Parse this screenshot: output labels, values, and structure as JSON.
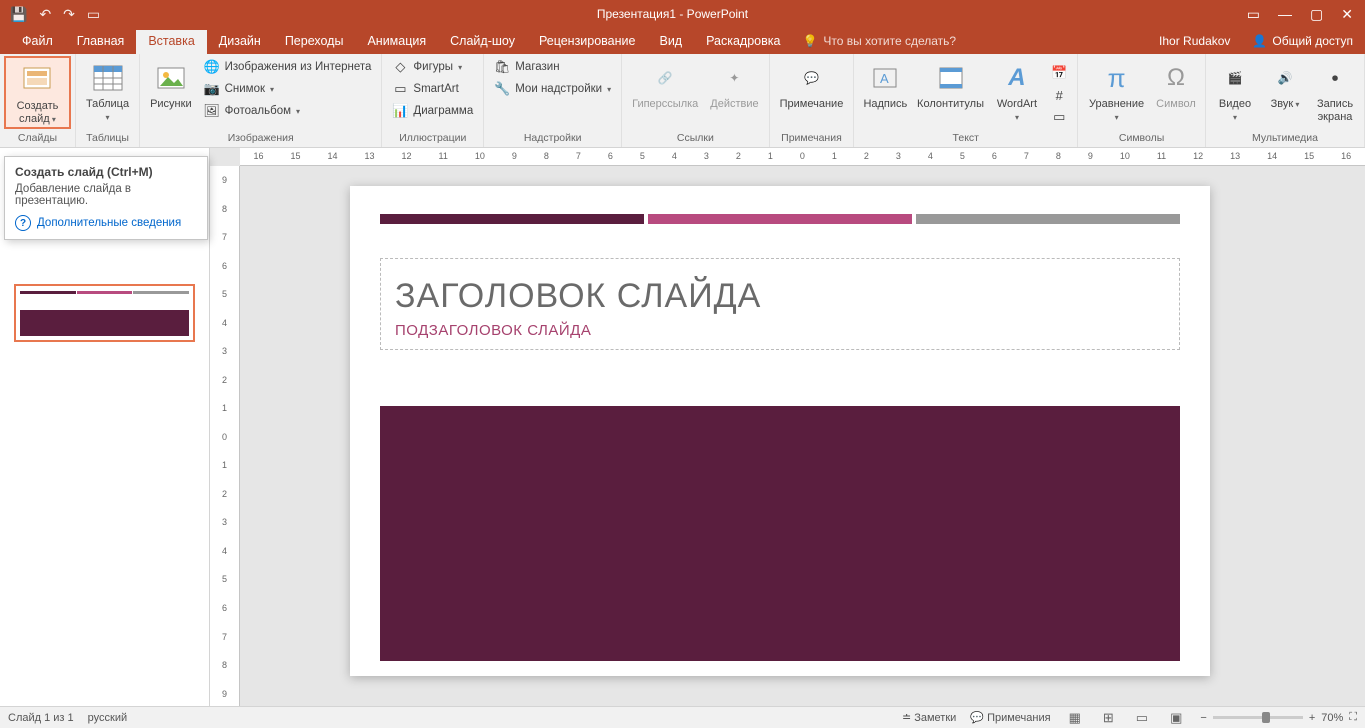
{
  "titlebar": {
    "title": "Презентация1 - PowerPoint"
  },
  "tabs": {
    "file": "Файл",
    "home": "Главная",
    "insert": "Вставка",
    "design": "Дизайн",
    "transitions": "Переходы",
    "animations": "Анимация",
    "slideshow": "Слайд-шоу",
    "review": "Рецензирование",
    "view": "Вид",
    "storyboard": "Раскадровка",
    "tell": "Что вы хотите сделать?",
    "user": "Ihor Rudakov",
    "share": "Общий доступ"
  },
  "ribbon": {
    "slides": {
      "new_slide": "Создать слайд",
      "group": "Слайды"
    },
    "tables": {
      "table": "Таблица",
      "group": "Таблицы"
    },
    "images": {
      "pictures": "Рисунки",
      "online": "Изображения из Интернета",
      "screenshot": "Снимок",
      "album": "Фотоальбом",
      "group": "Изображения"
    },
    "illustr": {
      "shapes": "Фигуры",
      "smartart": "SmartArt",
      "chart": "Диаграмма",
      "group": "Иллюстрации"
    },
    "addins": {
      "store": "Магазин",
      "myaddins": "Мои надстройки",
      "group": "Надстройки"
    },
    "links": {
      "hyperlink": "Гиперссылка",
      "action": "Действие",
      "group": "Ссылки"
    },
    "comments": {
      "comment": "Примечание",
      "group": "Примечания"
    },
    "text": {
      "textbox": "Надпись",
      "header": "Колонтитулы",
      "wordart": "WordArt",
      "group": "Текст"
    },
    "symbols": {
      "equation": "Уравнение",
      "symbol": "Символ",
      "group": "Символы"
    },
    "media": {
      "video": "Видео",
      "audio": "Звук",
      "screenrec": "Запись экрана",
      "group": "Мультимедиа"
    }
  },
  "tooltip": {
    "title": "Создать слайд (Ctrl+M)",
    "body": "Добавление слайда в презентацию.",
    "link": "Дополнительные сведения"
  },
  "slide": {
    "title": "ЗАГОЛОВОК СЛАЙДА",
    "subtitle": "ПОДЗАГОЛОВОК СЛАЙДА"
  },
  "ruler": {
    "h": [
      "16",
      "15",
      "14",
      "13",
      "12",
      "11",
      "10",
      "9",
      "8",
      "7",
      "6",
      "5",
      "4",
      "3",
      "2",
      "1",
      "0",
      "1",
      "2",
      "3",
      "4",
      "5",
      "6",
      "7",
      "8",
      "9",
      "10",
      "11",
      "12",
      "13",
      "14",
      "15",
      "16"
    ],
    "v": [
      "9",
      "8",
      "7",
      "6",
      "5",
      "4",
      "3",
      "2",
      "1",
      "0",
      "1",
      "2",
      "3",
      "4",
      "5",
      "6",
      "7",
      "8",
      "9"
    ]
  },
  "status": {
    "slide": "Слайд 1 из 1",
    "lang": "русский",
    "notes": "Заметки",
    "comments": "Примечания",
    "zoom": "70%"
  }
}
